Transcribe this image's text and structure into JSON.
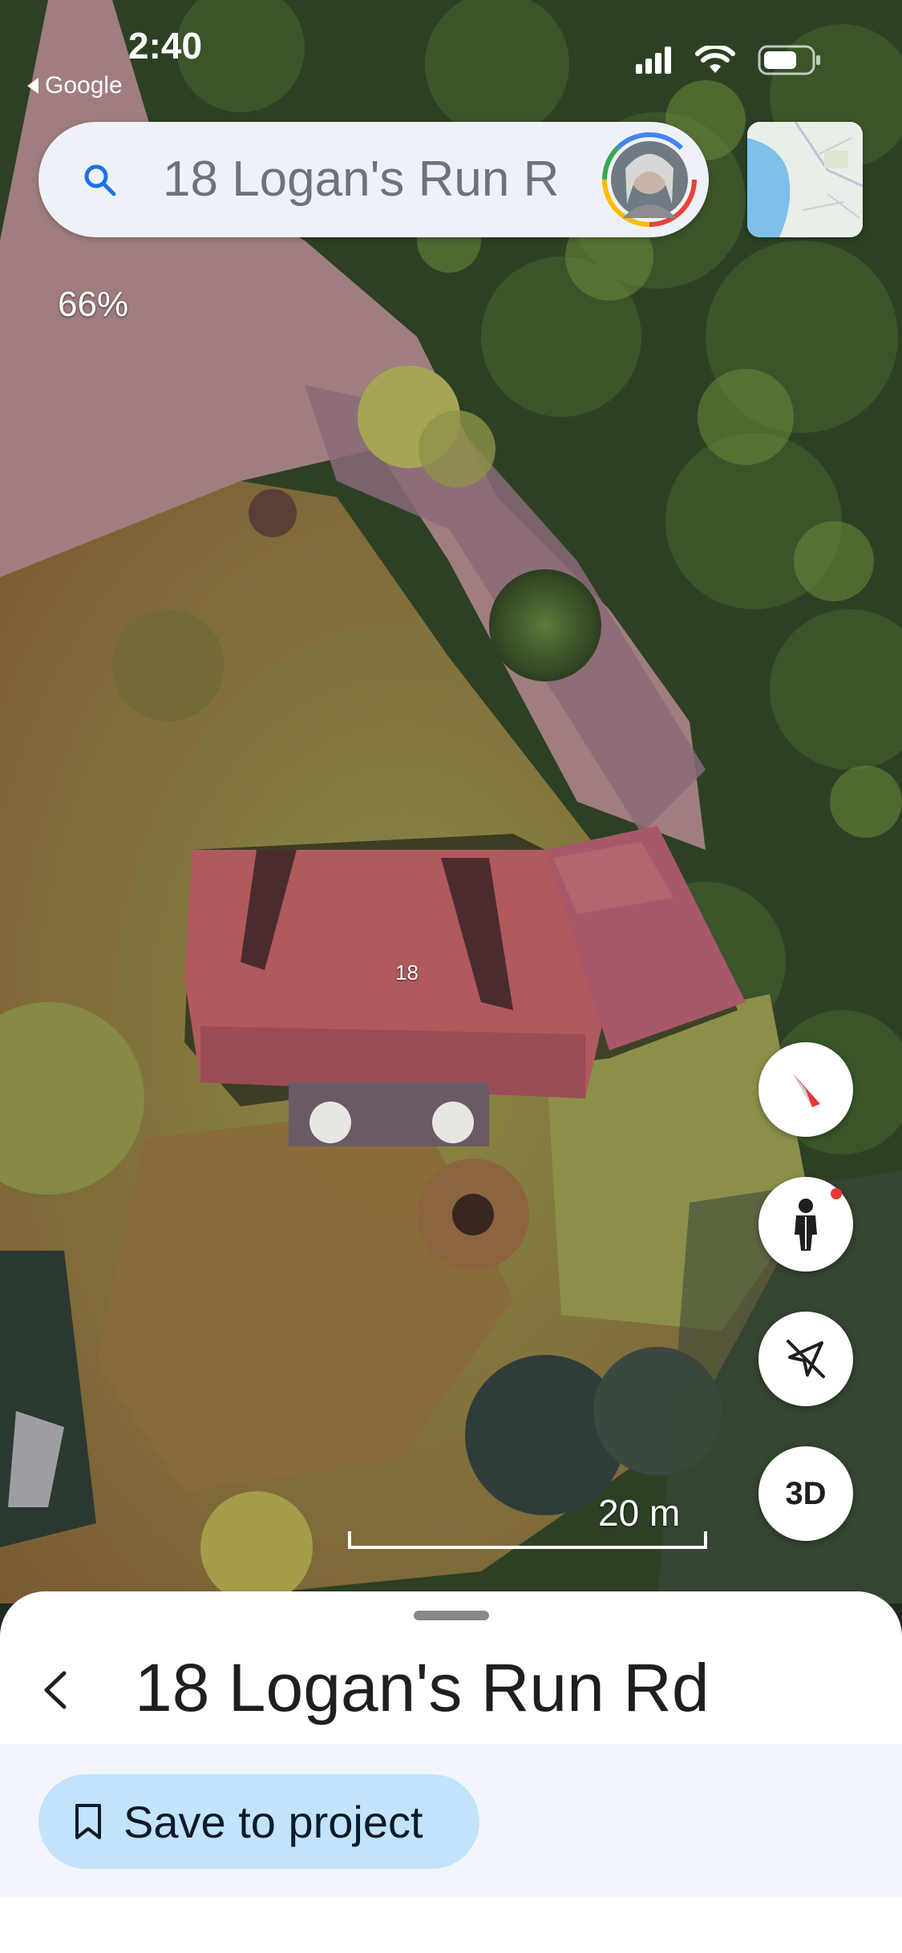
{
  "status_bar": {
    "time": "2:40",
    "back_app": "Google",
    "icons": [
      "cellular-signal-icon",
      "wifi-icon",
      "battery-icon"
    ]
  },
  "search": {
    "value": "18 Logan's Run R",
    "icon": "search-icon"
  },
  "map": {
    "zoom_label": "66%",
    "house_number": "18",
    "scale_label": "20 m",
    "view_mode_label": "3D"
  },
  "controls": {
    "icons": [
      "compass-icon",
      "street-view-pegman-icon",
      "location-off-icon"
    ],
    "pegman_badge_color": "#e53935"
  },
  "place": {
    "title": "18 Logan's Run Rd",
    "save_label": "Save to project"
  },
  "colors": {
    "search_bg": "#eef2f8",
    "save_button_bg": "#c2e3fb",
    "sheet_band_bg": "#f2f6fc",
    "roof": "#b05a5e"
  }
}
